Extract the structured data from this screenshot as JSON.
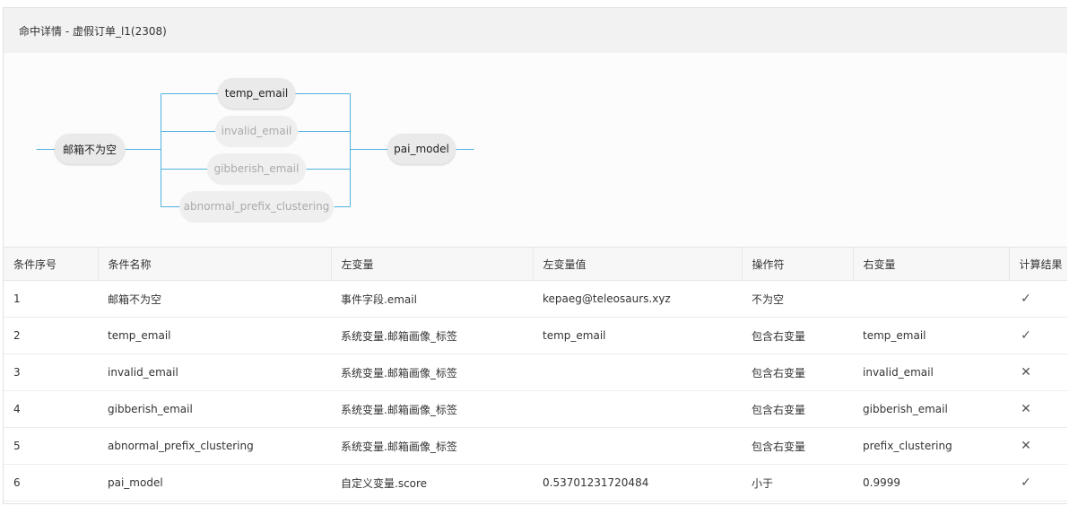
{
  "panel": {
    "title": "命中详情 - 虚假订单_l1(2308)"
  },
  "flow": {
    "start": "邮箱不为空",
    "branches": [
      {
        "label": "temp_email",
        "state": "active"
      },
      {
        "label": "invalid_email",
        "state": "inactive"
      },
      {
        "label": "gibberish_email",
        "state": "inactive"
      },
      {
        "label": "abnormal_prefix_clustering",
        "state": "inactive"
      }
    ],
    "end": "pai_model",
    "line_color": "#4fb3dd"
  },
  "table": {
    "headers": [
      "条件序号",
      "条件名称",
      "左变量",
      "左变量值",
      "操作符",
      "右变量",
      "计算结果"
    ],
    "rows": [
      {
        "index": "1",
        "name": "邮箱不为空",
        "left_var": "事件字段.email",
        "left_val": "kepaeg@teleosaurs.xyz",
        "operator": "不为空",
        "right_var": "",
        "result": "✓"
      },
      {
        "index": "2",
        "name": "temp_email",
        "left_var": "系统变量.邮箱画像_标签",
        "left_val": "temp_email",
        "operator": "包含右变量",
        "right_var": "temp_email",
        "result": "✓"
      },
      {
        "index": "3",
        "name": "invalid_email",
        "left_var": "系统变量.邮箱画像_标签",
        "left_val": "",
        "operator": "包含右变量",
        "right_var": "invalid_email",
        "result": "✕"
      },
      {
        "index": "4",
        "name": "gibberish_email",
        "left_var": "系统变量.邮箱画像_标签",
        "left_val": "",
        "operator": "包含右变量",
        "right_var": "gibberish_email",
        "result": "✕"
      },
      {
        "index": "5",
        "name": "abnormal_prefix_clustering",
        "left_var": "系统变量.邮箱画像_标签",
        "left_val": "",
        "operator": "包含右变量",
        "right_var": "prefix_clustering",
        "result": "✕"
      },
      {
        "index": "6",
        "name": "pai_model",
        "left_var": "自定义变量.score",
        "left_val": "0.53701231720484",
        "operator": "小于",
        "right_var": "0.9999",
        "result": "✓"
      }
    ]
  }
}
